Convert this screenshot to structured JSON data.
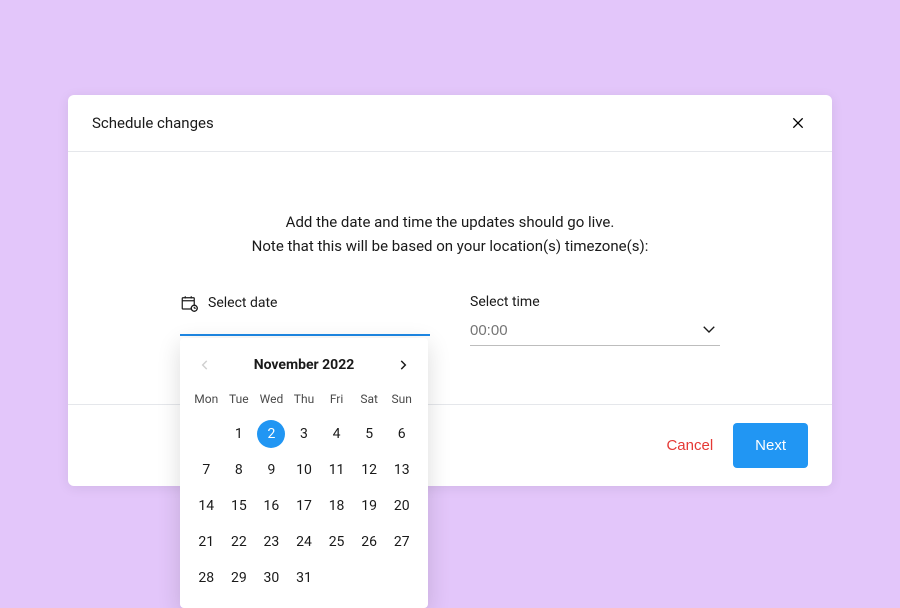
{
  "header": {
    "title": "Schedule changes"
  },
  "body": {
    "instruction_line1": "Add the date and time the updates should go live.",
    "instruction_line2": "Note that this will be based on your location(s) timezone(s):",
    "date_label": "Select date",
    "time_label": "Select time",
    "time_placeholder": "00:00"
  },
  "calendar": {
    "month_label": "November 2022",
    "weekdays": [
      "Mon",
      "Tue",
      "Wed",
      "Thu",
      "Fri",
      "Sat",
      "Sun"
    ],
    "leading_blanks": 1,
    "days_in_month": 31,
    "selected_day": 2,
    "prev_enabled": false,
    "next_enabled": true
  },
  "footer": {
    "cancel_label": "Cancel",
    "next_label": "Next"
  }
}
